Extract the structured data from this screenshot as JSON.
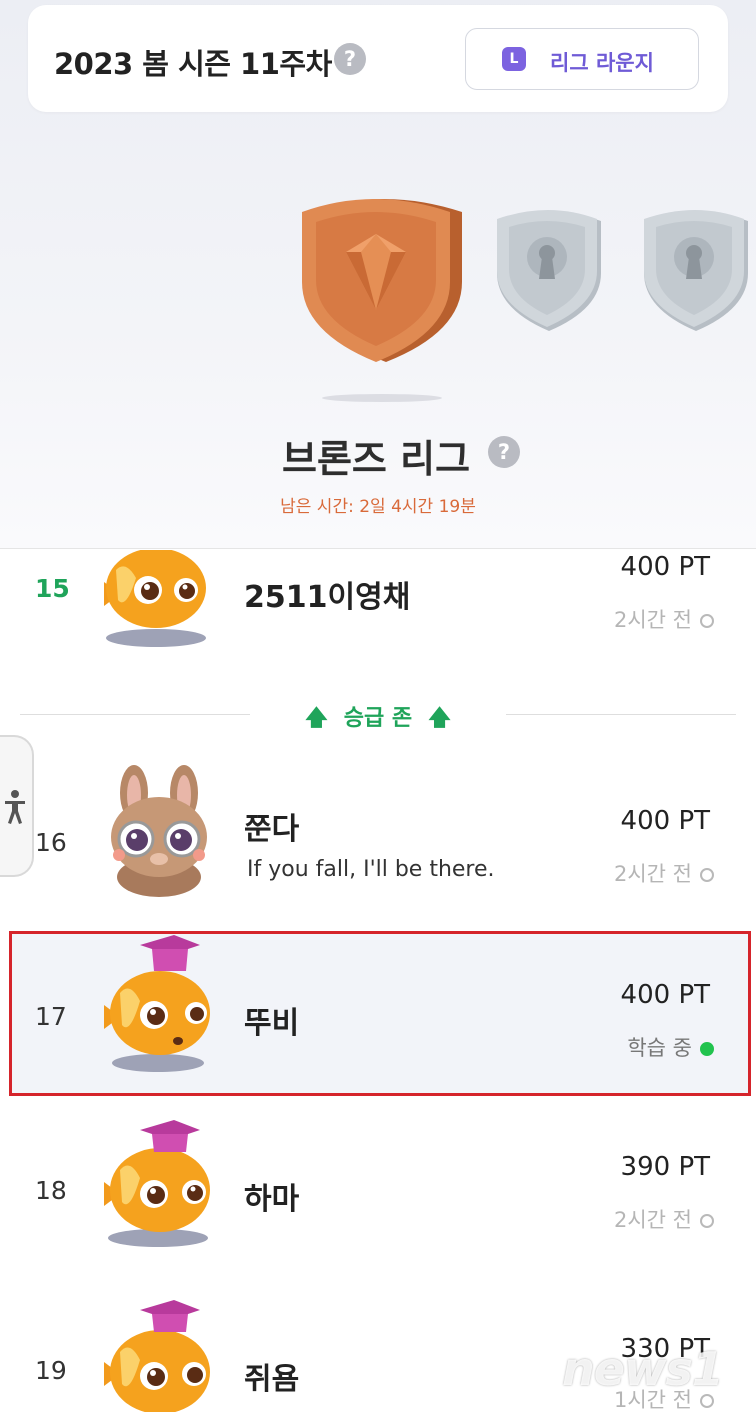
{
  "season": {
    "title": "2023 봄 시즌 11주차",
    "help": "?",
    "lounge_button": "리그 라운지",
    "lounge_icon_letter": "L"
  },
  "league": {
    "name": "브론즈 리그",
    "help": "?",
    "remaining_time": "남은 시간: 2일 4시간 19분"
  },
  "promotion_zone": {
    "label": "승급 존",
    "arrow": "🡅"
  },
  "rows": [
    {
      "rank": "15",
      "name": "2511이영채",
      "bio": "",
      "points": "400 PT",
      "status": "2시간 전",
      "active": false,
      "avatar": "orange-fish"
    },
    {
      "rank": "16",
      "name": "쭌다",
      "bio": "If you fall, I'll be there.",
      "points": "400 PT",
      "status": "2시간 전",
      "active": false,
      "avatar": "bunny"
    },
    {
      "rank": "17",
      "name": "뚜비",
      "bio": "",
      "points": "400 PT",
      "status": "학습 중",
      "active": true,
      "avatar": "orange-fish-grad-cap"
    },
    {
      "rank": "18",
      "name": "하마",
      "bio": "",
      "points": "390 PT",
      "status": "2시간 전",
      "active": false,
      "avatar": "orange-fish-grad-cap"
    },
    {
      "rank": "19",
      "name": "쥐욤",
      "bio": "",
      "points": "330 PT",
      "status": "1시간 전",
      "active": false,
      "avatar": "orange-fish-grad-cap"
    }
  ],
  "watermark": "news1",
  "colors": {
    "bronze": "#d9834f",
    "locked": "#c4cbd1",
    "promo_green": "#1fa45a",
    "active_dot": "#22c34e",
    "highlight_border": "#d5242b",
    "lounge_purple": "#7c63e0"
  }
}
